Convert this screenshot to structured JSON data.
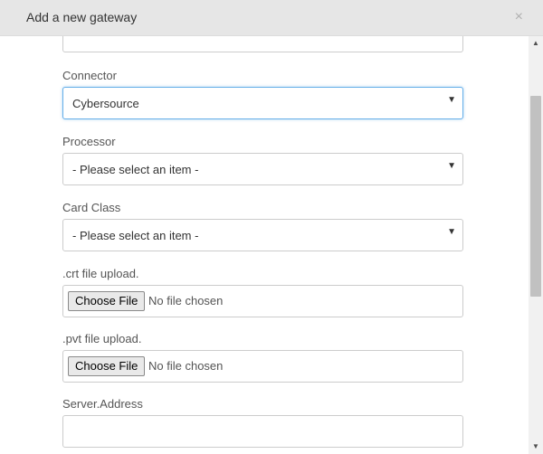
{
  "modal": {
    "title": "Add a new gateway",
    "close_label": "×"
  },
  "fields": {
    "connector": {
      "label": "Connector",
      "value": "Cybersource"
    },
    "processor": {
      "label": "Processor",
      "value": "- Please select an item -"
    },
    "card_class": {
      "label": "Card Class",
      "value": "- Please select an item -"
    },
    "crt_upload": {
      "label": ".crt file upload.",
      "button_label": "Choose File",
      "status": "No file chosen"
    },
    "pvt_upload": {
      "label": ".pvt file upload.",
      "button_label": "Choose File",
      "status": "No file chosen"
    },
    "server_address": {
      "label": "Server.Address",
      "value": ""
    }
  },
  "icons": {
    "dropdown_caret": "▼",
    "scroll_up": "▲",
    "scroll_down": "▼"
  }
}
